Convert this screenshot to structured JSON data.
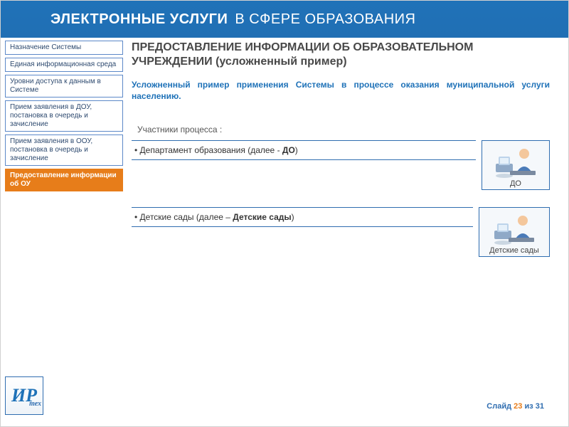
{
  "header": {
    "strong": "ЭЛЕКТРОННЫЕ УСЛУГИ",
    "light": "В СФЕРЕ ОБРАЗОВАНИЯ"
  },
  "sidebar": {
    "items": [
      {
        "label": "Назначение Системы"
      },
      {
        "label": "Единая информационная среда"
      },
      {
        "label": "Уровни доступа к данным в Системе"
      },
      {
        "label": "Прием заявления в ДОУ, постановка в очередь и зачисление"
      },
      {
        "label": "Прием заявления в ООУ, постановка в очередь и зачисление"
      },
      {
        "label": "Предоставление информации об ОУ"
      }
    ],
    "active_index": 5
  },
  "page": {
    "title_line1": "ПРЕДОСТАВЛЕНИЕ ИНФОРМАЦИИ ОБ ОБРАЗОВАТЕЛЬНОМ",
    "title_line2": "УЧРЕЖДЕНИИ (усложненный пример)",
    "intro": "Усложненный пример применения Системы в процессе оказания муниципальной услуги населению.",
    "section_label": "Участники процесса :"
  },
  "participants": [
    {
      "text_prefix": "• Департамент образования (далее - ",
      "text_bold": "ДО",
      "text_suffix": ")",
      "caption": "ДО"
    },
    {
      "text_prefix": "• Детские сады (далее – ",
      "text_bold": "Детские сады",
      "text_suffix": ")",
      "caption": "Детские сады"
    }
  ],
  "logo": {
    "mark": "ИР",
    "sub": "тех"
  },
  "footer": {
    "prefix": "Слайд ",
    "current": "23",
    "of": " из ",
    "total": "31"
  }
}
